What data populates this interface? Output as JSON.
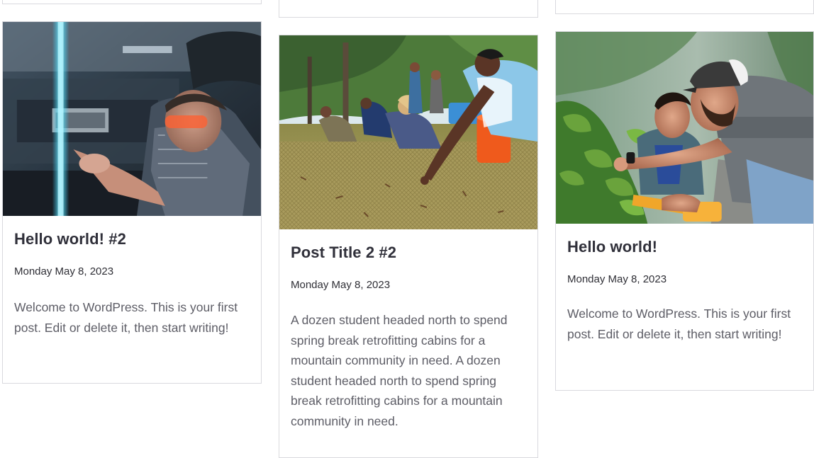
{
  "posts": [
    {
      "title": "Hello world! #2",
      "date": "Monday May 8, 2023",
      "excerpt": "Welcome to WordPress. This is your first post. Edit or delete it, then start writing!",
      "image_icon": "laser-lab-photo"
    },
    {
      "title": "Post Title 2 #2",
      "date": "Monday May 8, 2023",
      "excerpt": "A dozen student headed north to spend spring break retrofitting cabins for a mountain community in need. A dozen student headed north to spend spring break retrofitting cabins for a mountain community in need.",
      "image_icon": "field-work-photo"
    },
    {
      "title": "Hello world!",
      "date": "Monday May 8, 2023",
      "excerpt": "Welcome to WordPress. This is your first post. Edit or delete it, then start writing!",
      "image_icon": "plant-measurement-photo"
    }
  ],
  "colors": {
    "title": "#30303a",
    "body": "#5d5d66",
    "border": "#d9d9de",
    "background": "#ffffff"
  }
}
